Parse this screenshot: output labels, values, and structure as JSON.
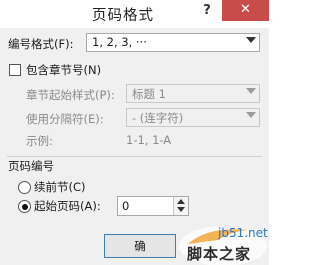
{
  "window": {
    "title": "页码格式",
    "help_glyph": "?",
    "close_glyph": "✕"
  },
  "number_format": {
    "label": "编号格式(F):",
    "value": "1, 2, 3, ···"
  },
  "include_chapter": {
    "label": "包含章节号(N)",
    "checked": false
  },
  "chapter_style": {
    "label": "章节起始样式(P):",
    "value": "标题 1"
  },
  "separator": {
    "label": "使用分隔符(E):",
    "value": "-  (连字符)"
  },
  "example": {
    "label": "示例:",
    "value": "1-1, 1-A"
  },
  "page_numbering": {
    "heading": "页码编号",
    "continue_label": "续前节(C)",
    "start_at_label": "起始页码(A):",
    "start_at_value": "0",
    "selected": "start_at"
  },
  "buttons": {
    "ok": "确"
  },
  "watermark": {
    "site": "jb51.net",
    "name": "脚本之家"
  }
}
